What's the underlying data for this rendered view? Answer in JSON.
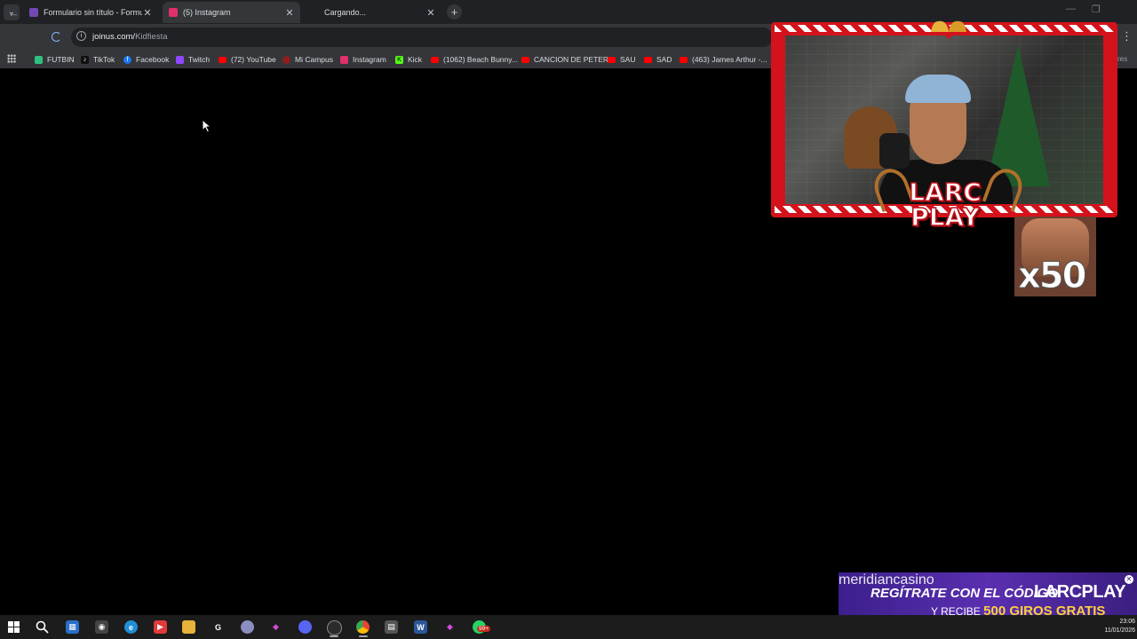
{
  "browser": {
    "tabs": [
      {
        "title": "Formulario sin título - Formula",
        "favicon_color": "#7248b9",
        "active": false
      },
      {
        "title": "(5) Instagram",
        "favicon_color": "#e1306c",
        "active": true
      },
      {
        "title": "Cargando...",
        "favicon_color": "#5f6368",
        "active": false
      }
    ],
    "url_host": "joinus.com/",
    "url_path": "Kidfiesta",
    "bookmarks": [
      {
        "label": "FUTBIN",
        "icon_color": "#2ec27e"
      },
      {
        "label": "TikTok",
        "icon_color": "#111111"
      },
      {
        "label": "Facebook",
        "icon_color": "#1877f2"
      },
      {
        "label": "Twitch",
        "icon_color": "#9146ff"
      },
      {
        "label": "(72) YouTube",
        "icon_color": "#ff0000"
      },
      {
        "label": "Mi Campus",
        "icon_color": "#8b1e1e"
      },
      {
        "label": "Instagram",
        "icon_color": "#e1306c"
      },
      {
        "label": "Kick",
        "icon_color": "#53fc18"
      },
      {
        "label": "(1062) Beach Bunny...",
        "icon_color": "#ff0000"
      },
      {
        "label": "CANCION DE PETER",
        "icon_color": "#ff0000"
      },
      {
        "label": "SAU",
        "icon_color": "#ff0000"
      },
      {
        "label": "SAD",
        "icon_color": "#ff0000"
      },
      {
        "label": "(463) James Arthur -...",
        "icon_color": "#ff0000"
      }
    ],
    "bookmarks_overflow": "res"
  },
  "stream_overlay": {
    "logo_line1": "LARC",
    "logo_line2": "PLAY",
    "multiplier": "x50"
  },
  "ad_banner": {
    "brand": "meridiancasino",
    "line1": "REGÍTRATE CON EL CÓDIGO",
    "code": "LARCPLAY",
    "line2_prefix": "Y RECIBE",
    "line2_highlight": "500 GIROS GRATIS"
  },
  "taskbar": {
    "time": "23:06",
    "date": "11/01/2026",
    "notification_badge": "99+",
    "apps": [
      "windows-icon",
      "search-icon",
      "store-icon",
      "cat-icon",
      "edge-icon",
      "red-app-icon",
      "folder-icon",
      "g-icon",
      "app-icon",
      "pink-app-icon",
      "discord-icon",
      "obs-icon",
      "chrome-icon",
      "calculator-icon",
      "word-icon",
      "pink-app2-icon",
      "whatsapp-icon"
    ]
  }
}
